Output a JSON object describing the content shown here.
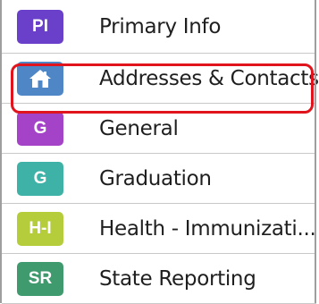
{
  "menu": {
    "items": [
      {
        "badge": "PI",
        "label": "Primary Info",
        "color": "#6a3fc9",
        "icon": ""
      },
      {
        "badge": "",
        "label": "Addresses & Contacts",
        "color": "#4f86c6",
        "icon": "home-icon",
        "selected": true
      },
      {
        "badge": "G",
        "label": "General",
        "color": "#a543c8",
        "icon": ""
      },
      {
        "badge": "G",
        "label": "Graduation",
        "color": "#3fb2a7",
        "icon": ""
      },
      {
        "badge": "H-I",
        "label": "Health - Immunizati...",
        "color": "#b5cc3b",
        "icon": ""
      },
      {
        "badge": "SR",
        "label": "State Reporting",
        "color": "#3f9a6e",
        "icon": ""
      }
    ]
  },
  "highlight_color": "#e0141c"
}
